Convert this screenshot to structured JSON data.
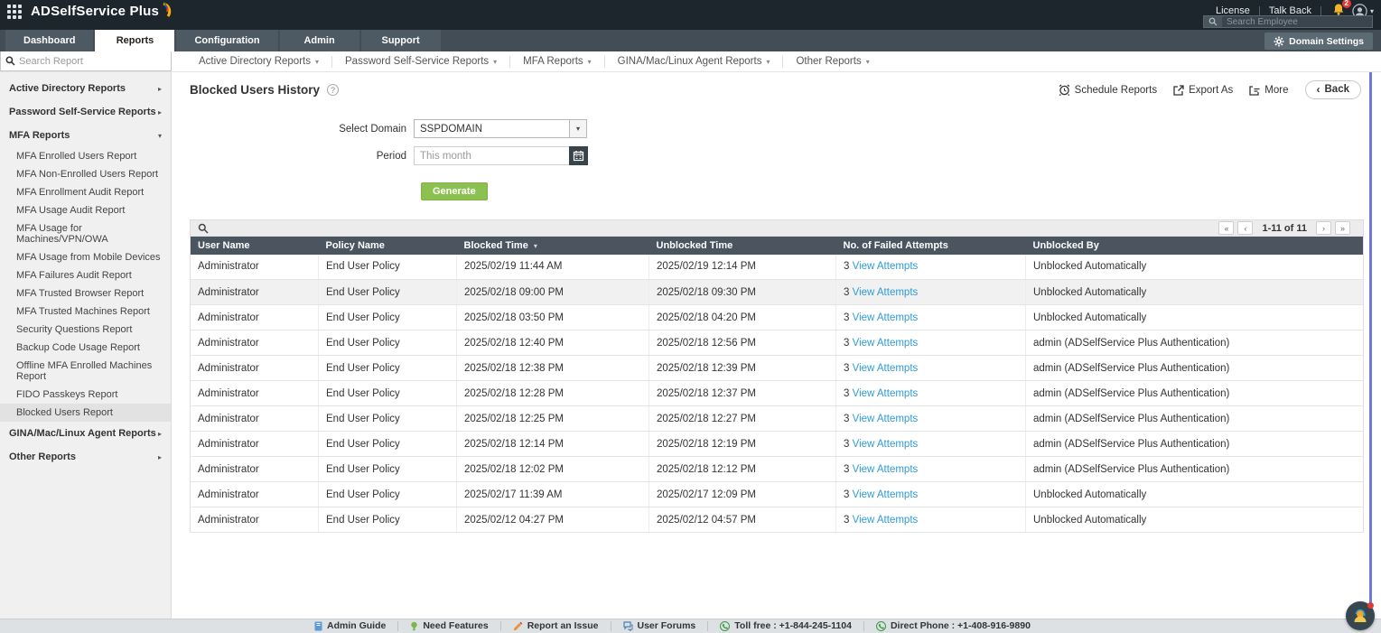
{
  "header": {
    "brand": "ADSelfService Plus",
    "license_label": "License",
    "talkback_label": "Talk Back",
    "notification_count": "2",
    "search_employee_placeholder": "Search Employee",
    "domain_settings_label": "Domain Settings"
  },
  "tabs": [
    {
      "label": "Dashboard",
      "active": false
    },
    {
      "label": "Reports",
      "active": true
    },
    {
      "label": "Configuration",
      "active": false
    },
    {
      "label": "Admin",
      "active": false
    },
    {
      "label": "Support",
      "active": false
    }
  ],
  "menus": [
    {
      "label": "Active Directory Reports"
    },
    {
      "label": "Password Self-Service Reports"
    },
    {
      "label": "MFA Reports"
    },
    {
      "label": "GINA/Mac/Linux Agent Reports"
    },
    {
      "label": "Other Reports"
    }
  ],
  "sidebar": {
    "search_placeholder": "Search Report",
    "items": [
      {
        "label": "Active Directory Reports",
        "is_group": true,
        "arrow": "▸",
        "selected": false
      },
      {
        "label": "Password Self-Service Reports",
        "is_group": true,
        "arrow": "▸",
        "selected": false
      },
      {
        "label": "MFA Reports",
        "is_group": true,
        "arrow": "▾",
        "selected": false
      },
      {
        "label": "MFA Enrolled Users Report",
        "is_group": false,
        "selected": false
      },
      {
        "label": "MFA Non-Enrolled Users Report",
        "is_group": false,
        "selected": false
      },
      {
        "label": "MFA Enrollment Audit Report",
        "is_group": false,
        "selected": false
      },
      {
        "label": "MFA Usage Audit Report",
        "is_group": false,
        "selected": false
      },
      {
        "label": "MFA Usage for Machines/VPN/OWA",
        "is_group": false,
        "selected": false
      },
      {
        "label": "MFA Usage from Mobile Devices",
        "is_group": false,
        "selected": false
      },
      {
        "label": "MFA Failures Audit Report",
        "is_group": false,
        "selected": false
      },
      {
        "label": "MFA Trusted Browser Report",
        "is_group": false,
        "selected": false
      },
      {
        "label": "MFA Trusted Machines Report",
        "is_group": false,
        "selected": false
      },
      {
        "label": "Security Questions Report",
        "is_group": false,
        "selected": false
      },
      {
        "label": "Backup Code Usage Report",
        "is_group": false,
        "selected": false
      },
      {
        "label": "Offline MFA Enrolled Machines Report",
        "is_group": false,
        "selected": false
      },
      {
        "label": "FIDO Passkeys Report",
        "is_group": false,
        "selected": false
      },
      {
        "label": "Blocked Users Report",
        "is_group": false,
        "selected": true
      },
      {
        "label": "GINA/Mac/Linux Agent Reports",
        "is_group": true,
        "arrow": "▸",
        "selected": false
      },
      {
        "label": "Other Reports",
        "is_group": true,
        "arrow": "▸",
        "selected": false
      }
    ]
  },
  "page": {
    "title": "Blocked Users History",
    "toolbar": {
      "schedule_label": "Schedule Reports",
      "export_label": "Export As",
      "more_label": "More",
      "back_label": "Back",
      "back_chevron": "‹"
    }
  },
  "form": {
    "domain_label": "Select Domain",
    "domain_value": "SSPDOMAIN",
    "period_label": "Period",
    "period_placeholder": "This month",
    "generate_label": "Generate"
  },
  "pagination": {
    "first": "«",
    "prev": "‹",
    "label": "1-11 of 11",
    "next": "›",
    "last": "»"
  },
  "table": {
    "columns": [
      {
        "label": "User Name",
        "sorted": false
      },
      {
        "label": "Policy Name",
        "sorted": false
      },
      {
        "label": "Blocked Time",
        "sorted": true
      },
      {
        "label": "Unblocked Time",
        "sorted": false
      },
      {
        "label": "No. of Failed Attempts",
        "sorted": false
      },
      {
        "label": "Unblocked By",
        "sorted": false
      }
    ],
    "rows": [
      {
        "user": "Administrator",
        "policy": "End User Policy",
        "blocked": "2025/02/19 11:44 AM",
        "unblocked": "2025/02/19 12:14 PM",
        "attempts": "3",
        "attempts_link": "View Attempts",
        "unblocked_by": "Unblocked Automatically",
        "highlighted": false
      },
      {
        "user": "Administrator",
        "policy": "End User Policy",
        "blocked": "2025/02/18 09:00 PM",
        "unblocked": "2025/02/18 09:30 PM",
        "attempts": "3",
        "attempts_link": "View Attempts",
        "unblocked_by": "Unblocked Automatically",
        "highlighted": true
      },
      {
        "user": "Administrator",
        "policy": "End User Policy",
        "blocked": "2025/02/18 03:50 PM",
        "unblocked": "2025/02/18 04:20 PM",
        "attempts": "3",
        "attempts_link": "View Attempts",
        "unblocked_by": "Unblocked Automatically",
        "highlighted": false
      },
      {
        "user": "Administrator",
        "policy": "End User Policy",
        "blocked": "2025/02/18 12:40 PM",
        "unblocked": "2025/02/18 12:56 PM",
        "attempts": "3",
        "attempts_link": "View Attempts",
        "unblocked_by": "admin (ADSelfService Plus Authentication)",
        "highlighted": false
      },
      {
        "user": "Administrator",
        "policy": "End User Policy",
        "blocked": "2025/02/18 12:38 PM",
        "unblocked": "2025/02/18 12:39 PM",
        "attempts": "3",
        "attempts_link": "View Attempts",
        "unblocked_by": "admin (ADSelfService Plus Authentication)",
        "highlighted": false
      },
      {
        "user": "Administrator",
        "policy": "End User Policy",
        "blocked": "2025/02/18 12:28 PM",
        "unblocked": "2025/02/18 12:37 PM",
        "attempts": "3",
        "attempts_link": "View Attempts",
        "unblocked_by": "admin (ADSelfService Plus Authentication)",
        "highlighted": false
      },
      {
        "user": "Administrator",
        "policy": "End User Policy",
        "blocked": "2025/02/18 12:25 PM",
        "unblocked": "2025/02/18 12:27 PM",
        "attempts": "3",
        "attempts_link": "View Attempts",
        "unblocked_by": "admin (ADSelfService Plus Authentication)",
        "highlighted": false
      },
      {
        "user": "Administrator",
        "policy": "End User Policy",
        "blocked": "2025/02/18 12:14 PM",
        "unblocked": "2025/02/18 12:19 PM",
        "attempts": "3",
        "attempts_link": "View Attempts",
        "unblocked_by": "admin (ADSelfService Plus Authentication)",
        "highlighted": false
      },
      {
        "user": "Administrator",
        "policy": "End User Policy",
        "blocked": "2025/02/18 12:02 PM",
        "unblocked": "2025/02/18 12:12 PM",
        "attempts": "3",
        "attempts_link": "View Attempts",
        "unblocked_by": "admin (ADSelfService Plus Authentication)",
        "highlighted": false
      },
      {
        "user": "Administrator",
        "policy": "End User Policy",
        "blocked": "2025/02/17 11:39 AM",
        "unblocked": "2025/02/17 12:09 PM",
        "attempts": "3",
        "attempts_link": "View Attempts",
        "unblocked_by": "Unblocked Automatically",
        "highlighted": false
      },
      {
        "user": "Administrator",
        "policy": "End User Policy",
        "blocked": "2025/02/12 04:27 PM",
        "unblocked": "2025/02/12 04:57 PM",
        "attempts": "3",
        "attempts_link": "View Attempts",
        "unblocked_by": "Unblocked Automatically",
        "highlighted": false
      }
    ]
  },
  "footer": {
    "links": {
      "admin_guide": "Admin Guide",
      "need_features": "Need Features",
      "report_issue": "Report an Issue",
      "user_forums": "User Forums",
      "toll_free": "Toll free : +1-844-245-1104",
      "direct_phone": "Direct Phone : +1-408-916-9890"
    }
  },
  "colors": {
    "header_dark": "#1d262d",
    "tabbar_slate": "#424d55",
    "table_header": "#4a5560",
    "accent_green": "#8cc152",
    "link_blue": "#2e9bd8",
    "badge_red": "#e53935",
    "bell_yellow": "#f0b429"
  }
}
